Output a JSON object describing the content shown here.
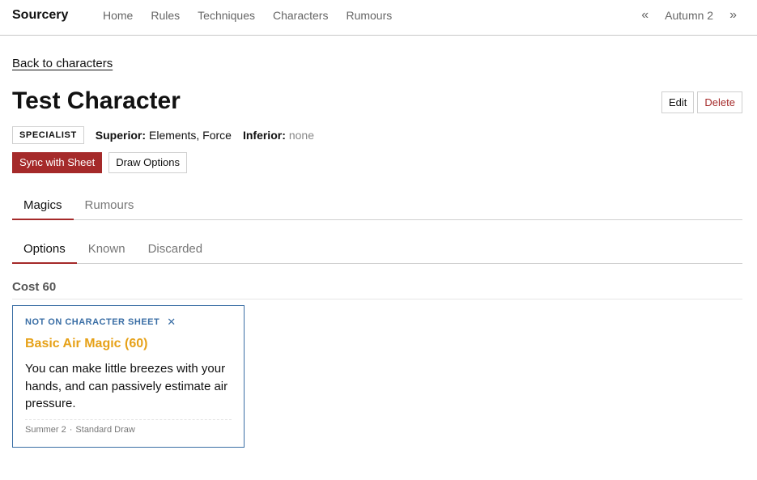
{
  "nav": {
    "brand": "Sourcery",
    "links": [
      "Home",
      "Rules",
      "Techniques",
      "Characters",
      "Rumours"
    ],
    "season": {
      "prev": "«",
      "label": "Autumn 2",
      "next": "»"
    }
  },
  "back_link": "Back to characters",
  "character": {
    "name": "Test Character",
    "edit_label": "Edit",
    "delete_label": "Delete",
    "badge": "SPECIALIST",
    "superior_key": "Superior:",
    "superior_val": "Elements, Force",
    "inferior_key": "Inferior:",
    "inferior_val": "none"
  },
  "actions": {
    "sync": "Sync with Sheet",
    "draw": "Draw Options"
  },
  "main_tabs": [
    {
      "label": "Magics",
      "active": true
    },
    {
      "label": "Rumours",
      "active": false
    }
  ],
  "sub_tabs": [
    {
      "label": "Options",
      "active": true
    },
    {
      "label": "Known",
      "active": false
    },
    {
      "label": "Discarded",
      "active": false
    }
  ],
  "cost_group": "Cost 60",
  "cards": [
    {
      "status": "NOT ON CHARACTER SHEET",
      "status_action": "✕",
      "title": "Basic Air Magic (60)",
      "description": "You can make little breezes with your hands, and can passively estimate air pressure.",
      "footer_season": "Summer 2",
      "footer_sep": "·",
      "footer_draw": "Standard Draw"
    }
  ],
  "colors": {
    "accent": "#a52a2a",
    "card_border": "#3a6ea5",
    "card_title": "#e6a118"
  }
}
